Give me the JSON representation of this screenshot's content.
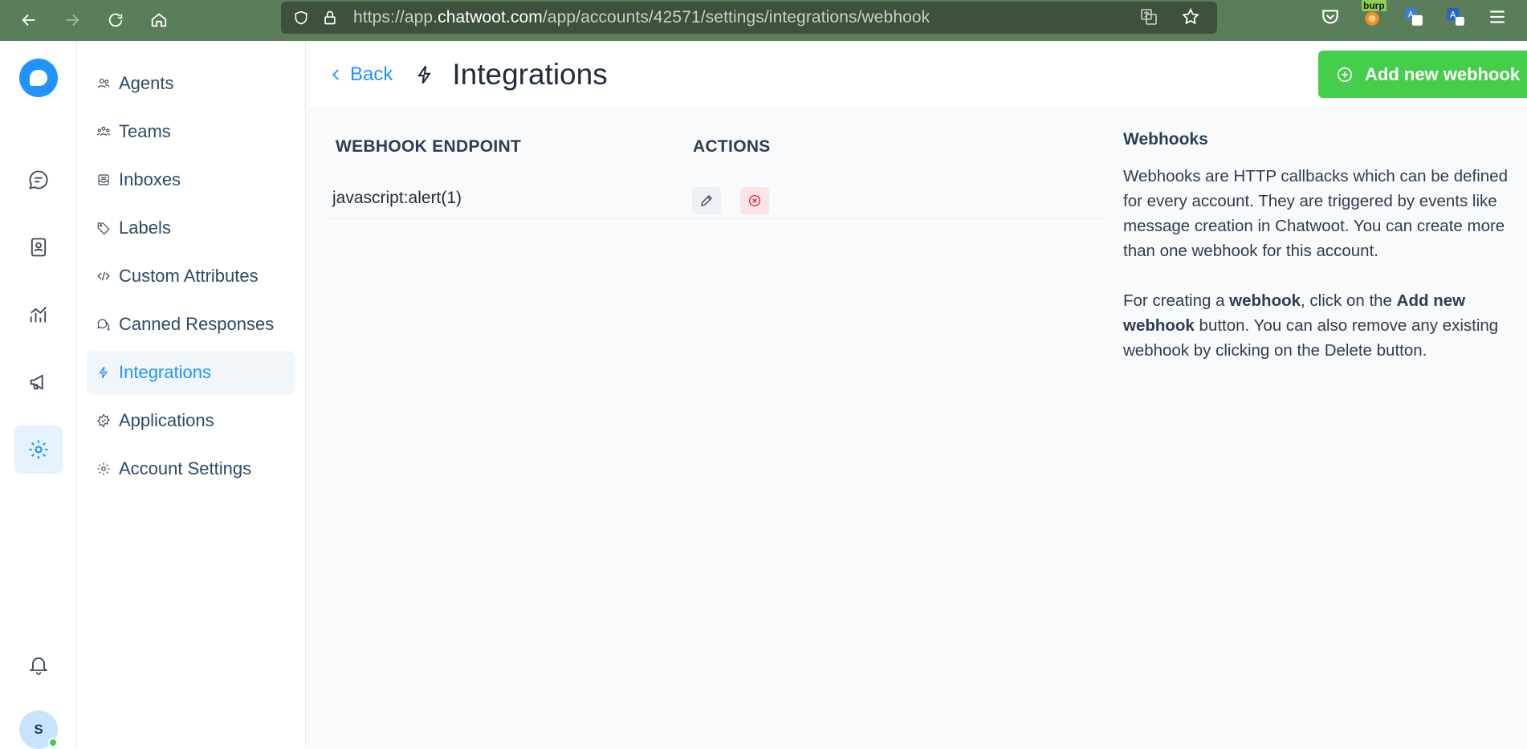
{
  "browser": {
    "url_prefix": "https://app.",
    "url_host": "chatwoot.com",
    "url_path": "/app/accounts/42571/settings/integrations/webhook",
    "extension_badge": "burp"
  },
  "rail": {
    "avatar_initial": "S"
  },
  "settings_nav": {
    "items": [
      {
        "label": "Agents",
        "icon": "agents-icon"
      },
      {
        "label": "Teams",
        "icon": "teams-icon"
      },
      {
        "label": "Inboxes",
        "icon": "inbox-icon"
      },
      {
        "label": "Labels",
        "icon": "label-icon"
      },
      {
        "label": "Custom Attributes",
        "icon": "code-icon"
      },
      {
        "label": "Canned Responses",
        "icon": "chat-bubbles-icon"
      },
      {
        "label": "Integrations",
        "icon": "lightning-icon",
        "active": true
      },
      {
        "label": "Applications",
        "icon": "star-badge-icon"
      },
      {
        "label": "Account Settings",
        "icon": "gear-icon"
      }
    ]
  },
  "header": {
    "back_label": "Back",
    "title": "Integrations",
    "add_button_label": "Add new webhook"
  },
  "table": {
    "headers": [
      "WEBHOOK ENDPOINT",
      "ACTIONS"
    ],
    "rows": [
      {
        "endpoint": "javascript:alert(1)"
      }
    ]
  },
  "info": {
    "title": "Webhooks",
    "paragraph1": "Webhooks are HTTP callbacks which can be defined for every account. They are triggered by events like message creation in Chatwoot. You can create more than one webhook for this account.",
    "p2_a": "For creating a ",
    "p2_b": "webhook",
    "p2_c": ", click on the ",
    "p2_d": "Add new webhook",
    "p2_e": " button. You can also remove any existing webhook by clicking on the Delete button."
  },
  "colors": {
    "accent": "#1f93ff",
    "success": "#44ce4b",
    "danger": "#e0243c",
    "browser_bar": "#5a7d5a"
  }
}
